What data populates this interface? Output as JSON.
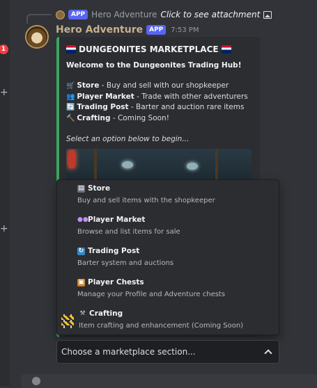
{
  "sidebar": {
    "unread_count": "1",
    "add_label": "+"
  },
  "reply": {
    "avatar_icon": "bot-avatar-icon",
    "app_tag": "APP",
    "author": "Hero Adventure",
    "text": "Click to see attachment",
    "attachment_icon": "image-icon"
  },
  "message": {
    "author": "Hero Adventure",
    "app_tag": "APP",
    "timestamp": "7:53 PM",
    "author_color": "#c8b08a"
  },
  "embed": {
    "accent_color": "#3ba55c",
    "title": "DUNGEONITES MARKETPLACE",
    "title_icon": "flag-icon",
    "welcome": "Welcome to the Dungeonites Trading Hub!",
    "items": [
      {
        "icon": "🛒",
        "label": "Store",
        "desc": " - Buy and sell with our shopkeeper"
      },
      {
        "icon": "👥",
        "label": "Player Market",
        "desc": " - Trade with other adventurers"
      },
      {
        "icon": "🔄",
        "label": "Trading Post",
        "desc": " - Barter and auction rare items"
      },
      {
        "icon": "🔨",
        "label": "Crafting",
        "desc": " - Coming Soon!"
      }
    ],
    "footer": "Select an option below to begin..."
  },
  "dropdown": {
    "options": [
      {
        "icon": "store-icon",
        "label": "Store",
        "description": "Buy and sell items with the shopkeeper"
      },
      {
        "icon": "player-market-icon",
        "label": "Player Market",
        "description": "Browse and list items for sale"
      },
      {
        "icon": "trading-post-icon",
        "label": "Trading Post",
        "description": "Barter system and auctions"
      },
      {
        "icon": "chest-icon",
        "label": "Player Chests",
        "description": "Manage your Profile and Adventure chests"
      },
      {
        "icon": "hammer-icon",
        "label": "Crafting",
        "description": "Item crafting and enhancement (Coming Soon)"
      }
    ]
  },
  "select": {
    "placeholder": "Choose a marketplace section..."
  },
  "colors": {
    "accent_app": "#5865f2",
    "embed_bar": "#3ba55c",
    "background": "#313338"
  }
}
